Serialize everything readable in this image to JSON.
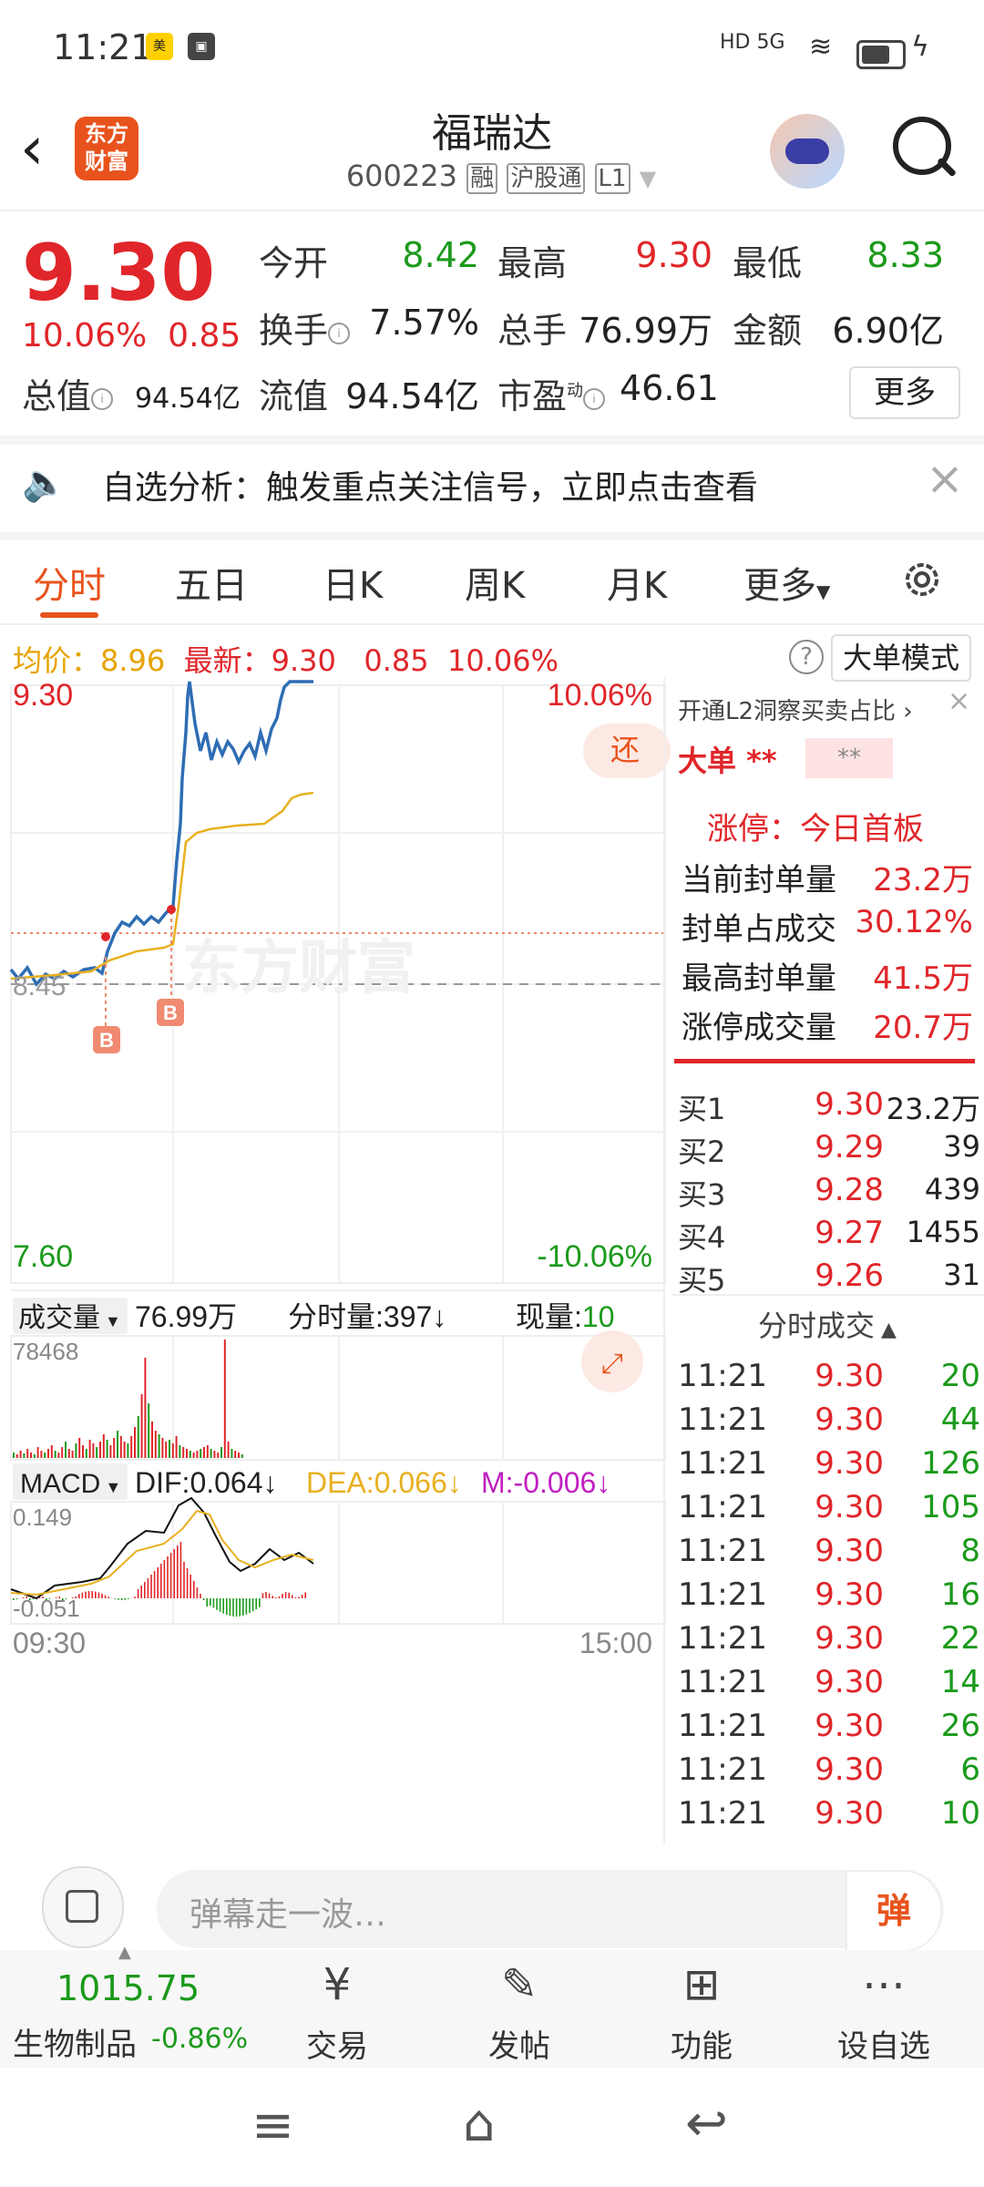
{
  "status": {
    "time": "11:21",
    "right": "HD 5G"
  },
  "header": {
    "name": "福瑞达",
    "code": "600223",
    "tags": [
      "融",
      "沪股通",
      "L1"
    ],
    "logo_line1": "东方",
    "logo_line2": "财富"
  },
  "quote": {
    "price": "9.30",
    "change_pct": "10.06%",
    "change": "0.85",
    "items": [
      {
        "label": "今开",
        "value": "8.42",
        "color": "green"
      },
      {
        "label": "最高",
        "value": "9.30",
        "color": "red"
      },
      {
        "label": "最低",
        "value": "8.33",
        "color": "green"
      },
      {
        "label": "换手",
        "value": "7.57%",
        "color": "black"
      },
      {
        "label": "总手",
        "value": "76.99万",
        "color": "black"
      },
      {
        "label": "金额",
        "value": "6.90亿",
        "color": "black"
      },
      {
        "label": "总值",
        "value": "94.54亿",
        "color": "black"
      },
      {
        "label": "流值",
        "value": "94.54亿",
        "color": "black"
      },
      {
        "label": "市盈",
        "value": "46.61",
        "color": "black"
      }
    ],
    "pe_sup": "动",
    "more": "更多"
  },
  "notice": {
    "text": "自选分析：触发重点关注信号，立即点击查看"
  },
  "tabs": [
    "分时",
    "五日",
    "日K",
    "周K",
    "月K",
    "更多"
  ],
  "avg": {
    "label": "均价：",
    "value": "8.96",
    "latest_label": "最新：",
    "latest": "9.30",
    "chg": "0.85",
    "pct": "10.06%"
  },
  "big_mode": "大单模式",
  "chart": {
    "top_price": "9.30",
    "top_pct": "10.06%",
    "bottom_price": "7.60",
    "bottom_pct": "-10.06%",
    "mid_price": "8.45",
    "watermark": "东方财富",
    "restore": "还",
    "vol_label": "成交量",
    "vol_total": "76.99万",
    "vol_minute": "分时量:397↓",
    "vol_now_label": "现量:",
    "vol_now": "10",
    "vol_max": "78468",
    "macd_label": "MACD",
    "dif": "DIF:0.064↓",
    "dea": "DEA:0.066↓",
    "m": "M:-0.006↓",
    "macd_max": "0.149",
    "macd_min": "-0.051",
    "time_start": "09:30",
    "time_end": "15:00",
    "buy_mark": "B"
  },
  "right_panel": {
    "l2": "开通L2洞察买卖占比 ›",
    "big_order": "大单",
    "stars1": "**",
    "stars2": "**",
    "limit_up": "涨停：今日首板",
    "stats": [
      {
        "label": "当前封单量",
        "value": "23.2万"
      },
      {
        "label": "封单占成交",
        "value": "30.12%"
      },
      {
        "label": "最高封单量",
        "value": "41.5万"
      },
      {
        "label": "涨停成交量",
        "value": "20.7万"
      }
    ],
    "bids": [
      {
        "label": "买1",
        "price": "9.30",
        "vol": "23.2万"
      },
      {
        "label": "买2",
        "price": "9.29",
        "vol": "39"
      },
      {
        "label": "买3",
        "price": "9.28",
        "vol": "439"
      },
      {
        "label": "买4",
        "price": "9.27",
        "vol": "1455"
      },
      {
        "label": "买5",
        "price": "9.26",
        "vol": "31"
      }
    ],
    "ticks_title": "分时成交",
    "ticks": [
      {
        "t": "11:21",
        "p": "9.30",
        "v": "20"
      },
      {
        "t": "11:21",
        "p": "9.30",
        "v": "44"
      },
      {
        "t": "11:21",
        "p": "9.30",
        "v": "126"
      },
      {
        "t": "11:21",
        "p": "9.30",
        "v": "105"
      },
      {
        "t": "11:21",
        "p": "9.30",
        "v": "8"
      },
      {
        "t": "11:21",
        "p": "9.30",
        "v": "16"
      },
      {
        "t": "11:21",
        "p": "9.30",
        "v": "22"
      },
      {
        "t": "11:21",
        "p": "9.30",
        "v": "14"
      },
      {
        "t": "11:21",
        "p": "9.30",
        "v": "26"
      },
      {
        "t": "11:21",
        "p": "9.30",
        "v": "6"
      },
      {
        "t": "11:21",
        "p": "9.30",
        "v": "10"
      }
    ]
  },
  "danmu": {
    "placeholder": "弹幕走一波…",
    "btn": "弹"
  },
  "bottom": {
    "index_value": "1015.75",
    "index_name": "生物制品",
    "index_pct": "-0.86%",
    "items": [
      "交易",
      "发帖",
      "功能",
      "设自选"
    ]
  }
}
